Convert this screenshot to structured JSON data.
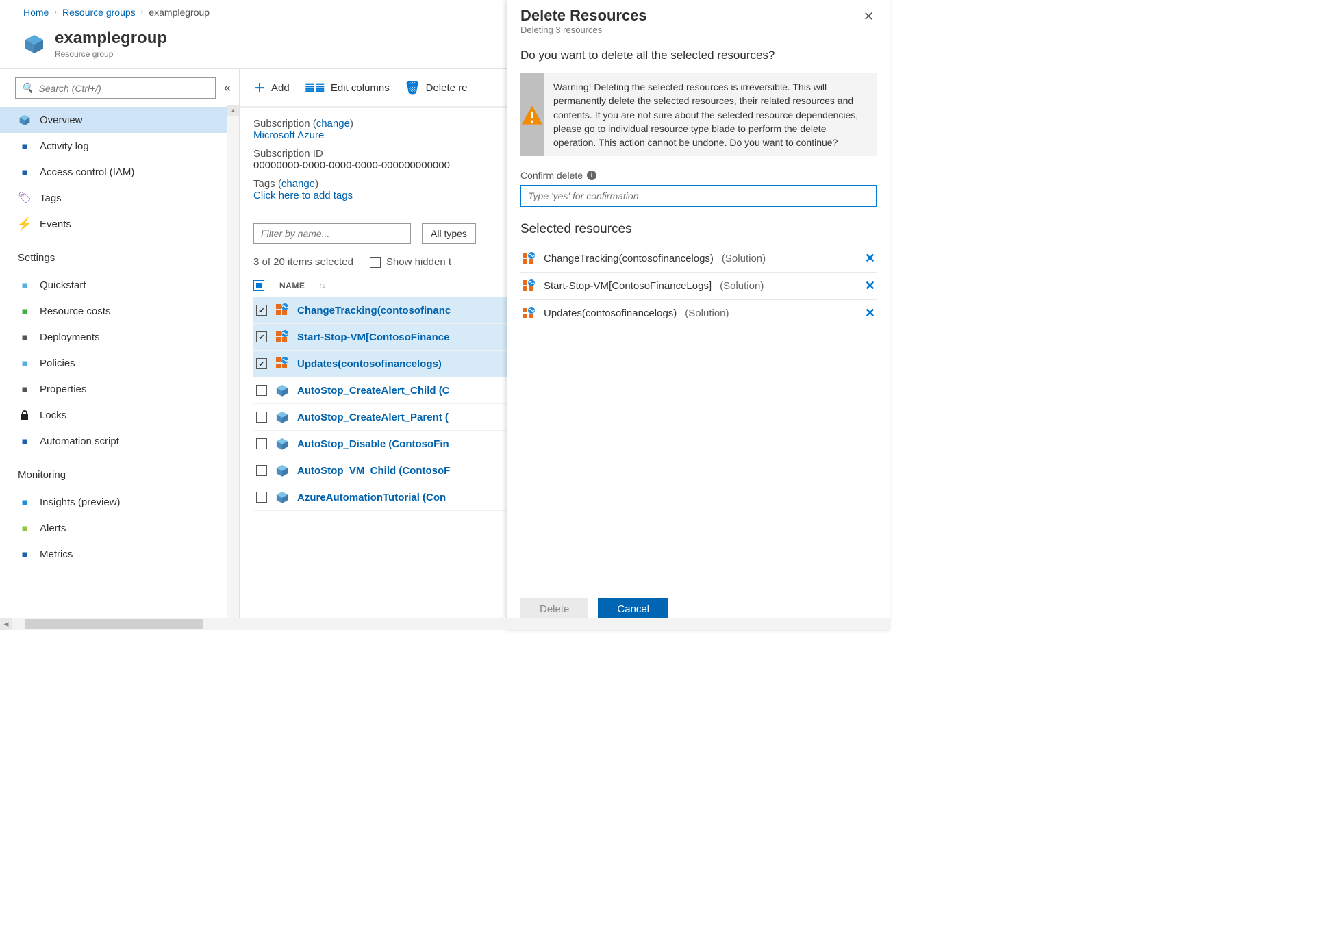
{
  "breadcrumb": {
    "home": "Home",
    "rg": "Resource groups",
    "current": "examplegroup"
  },
  "header": {
    "title": "examplegroup",
    "subtitle": "Resource group"
  },
  "sidebar": {
    "search_placeholder": "Search (Ctrl+/)",
    "items": [
      {
        "label": "Overview",
        "active": true,
        "icon": "cube"
      },
      {
        "label": "Activity log",
        "icon": "log"
      },
      {
        "label": "Access control (IAM)",
        "icon": "iam"
      },
      {
        "label": "Tags",
        "icon": "tag"
      },
      {
        "label": "Events",
        "icon": "bolt"
      }
    ],
    "settings_header": "Settings",
    "settings": [
      {
        "label": "Quickstart",
        "icon": "cloud"
      },
      {
        "label": "Resource costs",
        "icon": "cost"
      },
      {
        "label": "Deployments",
        "icon": "deploy"
      },
      {
        "label": "Policies",
        "icon": "policy"
      },
      {
        "label": "Properties",
        "icon": "props"
      },
      {
        "label": "Locks",
        "icon": "lock"
      },
      {
        "label": "Automation script",
        "icon": "script"
      }
    ],
    "monitoring_header": "Monitoring",
    "monitoring": [
      {
        "label": "Insights (preview)",
        "icon": "bulb"
      },
      {
        "label": "Alerts",
        "icon": "alert"
      },
      {
        "label": "Metrics",
        "icon": "metrics"
      }
    ]
  },
  "toolbar": {
    "add": "Add",
    "edit": "Edit columns",
    "del": "Delete re"
  },
  "info": {
    "sub_lbl": "Subscription",
    "change": "change",
    "sub_name": "Microsoft Azure",
    "subid_lbl": "Subscription ID",
    "subid": "00000000-0000-0000-0000-000000000000",
    "tags_lbl": "Tags",
    "tags_link": "Click here to add tags"
  },
  "filters": {
    "placeholder": "Filter by name...",
    "types": "All types"
  },
  "selection_text": "3 of 20 items selected",
  "showhidden": "Show hidden t",
  "thead": "NAME",
  "rows": [
    {
      "name": "ChangeTracking(contosofinanc",
      "sel": true,
      "type": "solution"
    },
    {
      "name": "Start-Stop-VM[ContosoFinance",
      "sel": true,
      "type": "solution"
    },
    {
      "name": "Updates(contosofinancelogs)",
      "sel": true,
      "type": "solution"
    },
    {
      "name": "AutoStop_CreateAlert_Child (C",
      "sel": false,
      "type": "runbook"
    },
    {
      "name": "AutoStop_CreateAlert_Parent (",
      "sel": false,
      "type": "runbook"
    },
    {
      "name": "AutoStop_Disable (ContosoFin",
      "sel": false,
      "type": "runbook"
    },
    {
      "name": "AutoStop_VM_Child (ContosoF",
      "sel": false,
      "type": "runbook"
    },
    {
      "name": "AzureAutomationTutorial (Con",
      "sel": false,
      "type": "runbook"
    }
  ],
  "panel": {
    "title": "Delete Resources",
    "subtitle": "Deleting 3 resources",
    "question": "Do you want to delete all the selected resources?",
    "warning": "Warning! Deleting the selected resources is irreversible. This will permanently delete the selected resources, their related resources and contents. If you are not sure about the selected resource dependencies, please go to individual resource type blade to perform the delete operation. This action cannot be undone. Do you want to continue?",
    "confirm_label": "Confirm delete",
    "confirm_placeholder": "Type 'yes' for confirmation",
    "selected_header": "Selected resources",
    "selected": [
      {
        "name": "ChangeTracking(contosofinancelogs)",
        "type": "(Solution)"
      },
      {
        "name": "Start-Stop-VM[ContosoFinanceLogs]",
        "type": "(Solution)"
      },
      {
        "name": "Updates(contosofinancelogs)",
        "type": "(Solution)"
      }
    ],
    "delete_btn": "Delete",
    "cancel_btn": "Cancel"
  }
}
